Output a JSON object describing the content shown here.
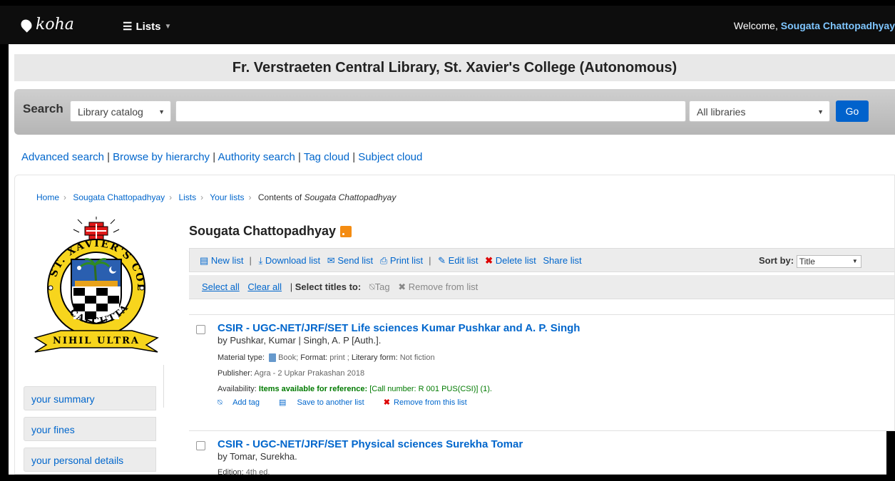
{
  "navbar": {
    "logo": "koha",
    "lists_label": "Lists",
    "welcome_prefix": "Welcome,",
    "user": "Sougata Chattopadhyay"
  },
  "library_name": "Fr. Verstraeten Central Library, St. Xavier's College (Autonomous)",
  "search": {
    "label": "Search",
    "catalog_select": "Library catalog",
    "library_select": "All libraries",
    "go": "Go"
  },
  "adv_links": [
    "Advanced search",
    "Browse by hierarchy",
    "Authority search",
    "Tag cloud",
    "Subject cloud"
  ],
  "breadcrumb": {
    "home": "Home",
    "user": "Sougata Chattopadhyay",
    "lists": "Lists",
    "your_lists": "Your lists",
    "contents_prefix": "Contents of",
    "contents_name": "Sougata Chattopadhyay"
  },
  "crest_text": {
    "ring": "ST. XAVIER'S COLLEGE CALCUTTA",
    "motto": "NIHIL ULTRA"
  },
  "sidebar": [
    "your summary",
    "your fines",
    "your personal details"
  ],
  "list": {
    "title": "Sougata Chattopadhyay",
    "toolbar": {
      "new_list": "New list",
      "download_list": "Download list",
      "send_list": "Send list",
      "print_list": "Print list",
      "edit_list": "Edit list",
      "delete_list": "Delete list",
      "share_list": "Share list",
      "sort_by": "Sort by:",
      "sort_value": "Title"
    },
    "selbar": {
      "select_all": "Select all",
      "clear_all": "Clear all",
      "select_titles_to": "Select titles to:",
      "tag": "Tag",
      "remove": "Remove from list"
    }
  },
  "results": [
    {
      "title": "CSIR - UGC-NET/JRF/SET Life sciences Kumar Pushkar and A. P. Singh",
      "by": "by Pushkar, Kumar | Singh, A. P [Auth.].",
      "material_label": "Material type:",
      "material_value": "Book;",
      "format_label": "Format:",
      "format_value": "print ;",
      "literary_label": "Literary form:",
      "literary_value": "Not fiction",
      "publisher_label": "Publisher:",
      "publisher_value": "Agra - 2 Upkar Prakashan 2018",
      "availability_label": "Availability:",
      "availability_value": "Items available for reference:",
      "availability_detail": "[Call number: R 001 PUS(CSI)] (1).",
      "add_tag": "Add tag",
      "save_to_list": "Save to another list",
      "remove_from_list": "Remove from this list"
    },
    {
      "title": "CSIR - UGC-NET/JRF/SET Physical sciences Surekha Tomar",
      "by": "by Tomar, Surekha.",
      "edition_label": "Edition:",
      "edition_value": "4th ed."
    }
  ]
}
